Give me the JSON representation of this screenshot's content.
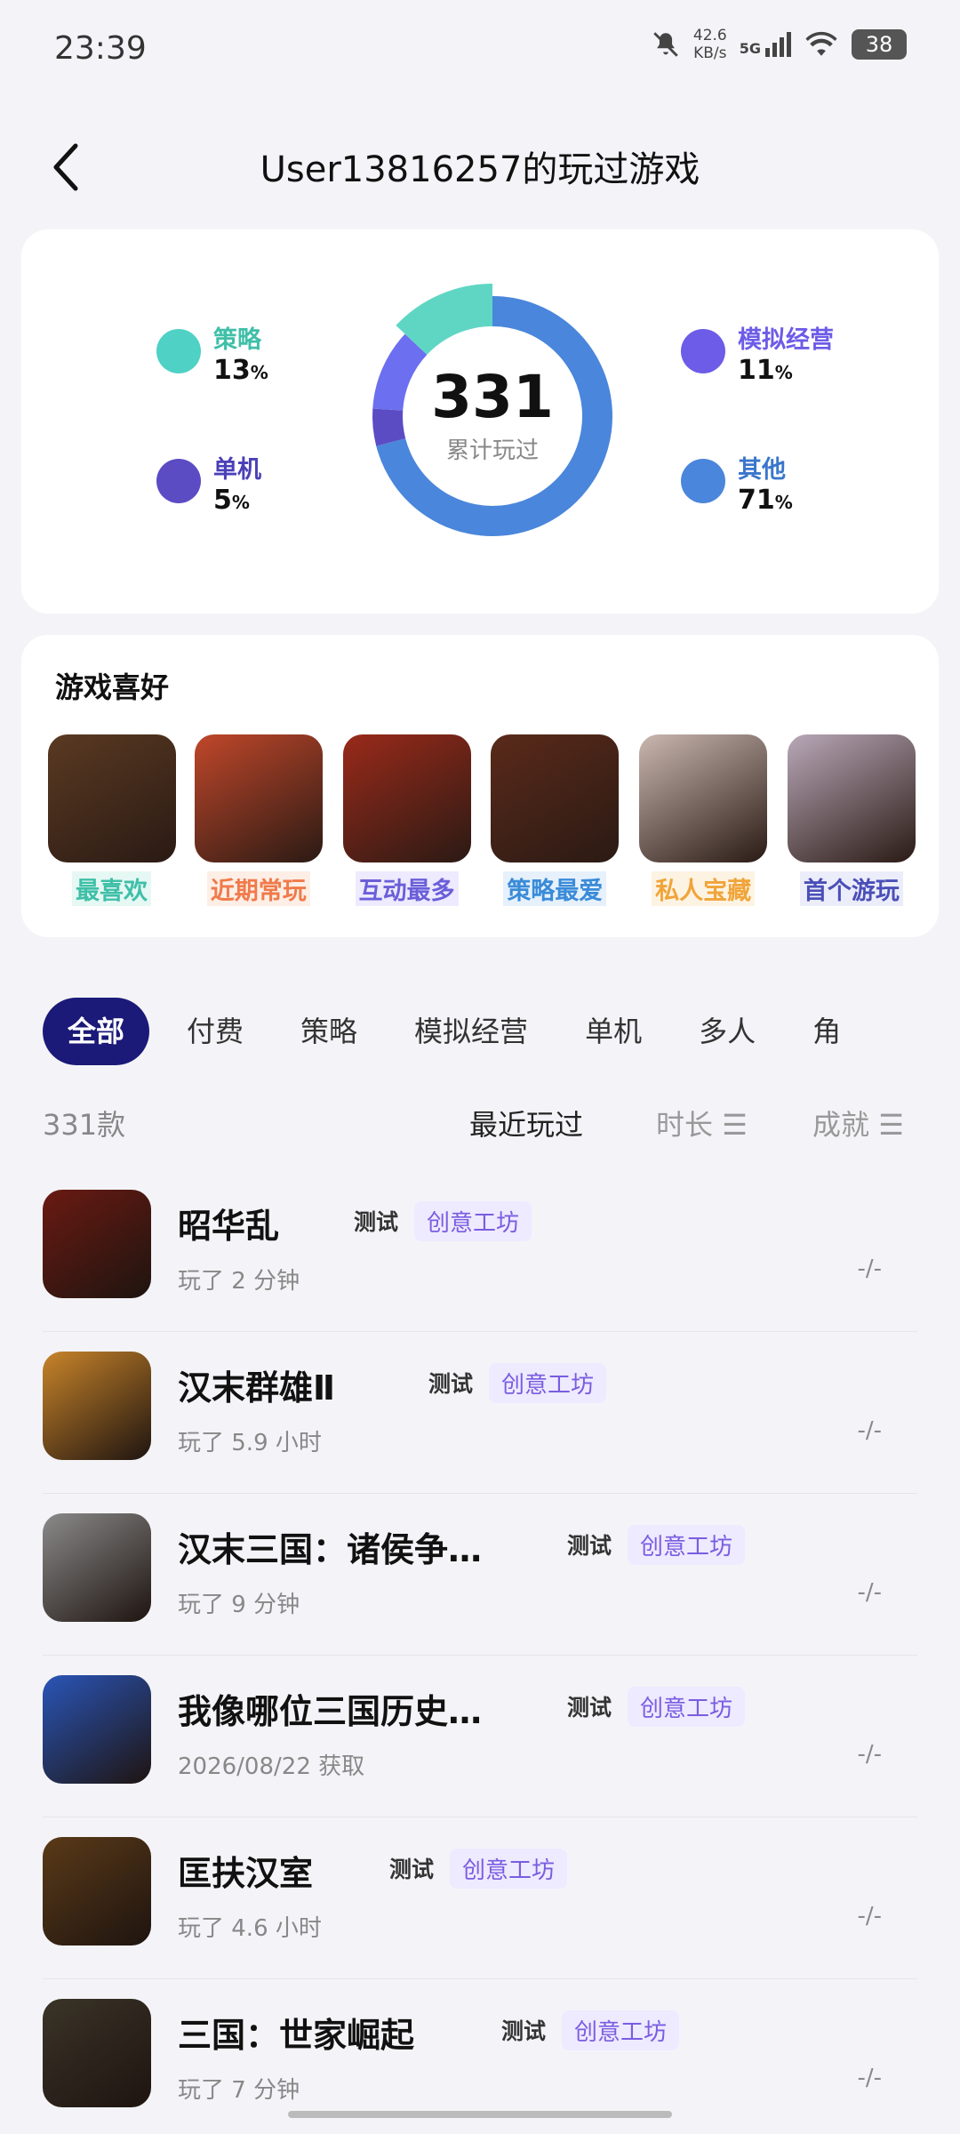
{
  "status": {
    "time": "23:39",
    "speed_value": "42.6",
    "speed_unit": "KB/s",
    "network": "5G",
    "battery": "38"
  },
  "header": {
    "title": "User13816257的玩过游戏"
  },
  "stats": {
    "total": "331",
    "total_label": "累计玩过",
    "categories": [
      {
        "name": "策略",
        "pct": "13",
        "unit": "%",
        "color": "#4fd1c5"
      },
      {
        "name": "单机",
        "pct": "5",
        "unit": "%",
        "color": "#5b4cc4"
      },
      {
        "name": "模拟经营",
        "pct": "11",
        "unit": "%",
        "color": "#6c5ce7"
      },
      {
        "name": "其他",
        "pct": "71",
        "unit": "%",
        "color": "#4a86db"
      }
    ],
    "donut": [
      {
        "value": 71,
        "color": "#4a86db"
      },
      {
        "value": 5,
        "color": "#5b4cc4"
      },
      {
        "value": 11,
        "color": "#6c6ff0"
      },
      {
        "value": 13,
        "color": "#5fd6c4"
      }
    ]
  },
  "preferences": {
    "title": "游戏喜好",
    "items": [
      {
        "label": "最喜欢",
        "color": "#3fbfa8",
        "bg": "#e6f8f3"
      },
      {
        "label": "近期常玩",
        "color": "#f07a4a",
        "bg": "#fdeee6"
      },
      {
        "label": "互动最多",
        "color": "#6a5fd8",
        "bg": "#eeeaff"
      },
      {
        "label": "策略最爱",
        "color": "#3a8bd8",
        "bg": "#e6f1fc"
      },
      {
        "label": "私人宝藏",
        "color": "#f0a43a",
        "bg": "#fdf3e2"
      },
      {
        "label": "首个游玩",
        "color": "#4a4fb8",
        "bg": "#ecedfa"
      }
    ]
  },
  "tabs": [
    "全部",
    "付费",
    "策略",
    "模拟经营",
    "单机",
    "多人",
    "角"
  ],
  "sort": {
    "count": "331款",
    "recent": "最近玩过",
    "duration": "时长",
    "achievement": "成就"
  },
  "games": [
    {
      "title": "昭华乱",
      "test": "测试",
      "tag": "创意工坊",
      "sub": "玩了 2 分钟",
      "score": "-/-"
    },
    {
      "title": "汉末群雄Ⅱ",
      "test": "测试",
      "tag": "创意工坊",
      "sub": "玩了 5.9 小时",
      "score": "-/-"
    },
    {
      "title": "汉末三国：诸侯争…",
      "test": "测试",
      "tag": "创意工坊",
      "sub": "玩了 9 分钟",
      "score": "-/-"
    },
    {
      "title": "我像哪位三国历史…",
      "test": "测试",
      "tag": "创意工坊",
      "sub": "2026/08/22 获取",
      "score": "-/-"
    },
    {
      "title": "匡扶汉室",
      "test": "测试",
      "tag": "创意工坊",
      "sub": "玩了 4.6 小时",
      "score": "-/-"
    },
    {
      "title": "三国：世家崛起",
      "test": "测试",
      "tag": "创意工坊",
      "sub": "玩了 7 分钟",
      "score": "-/-"
    }
  ]
}
